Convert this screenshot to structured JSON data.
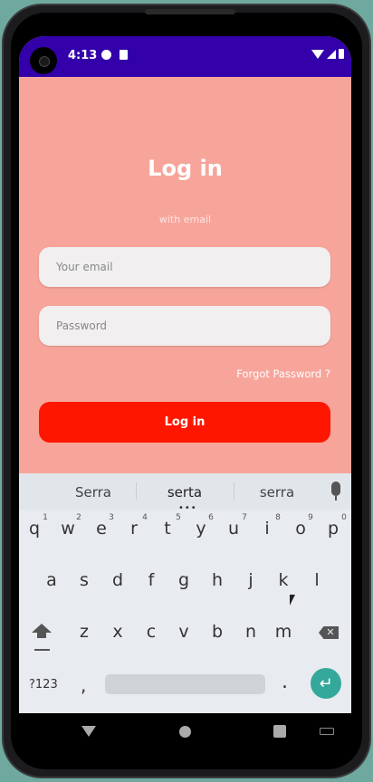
{
  "status": {
    "time": "4:13"
  },
  "login": {
    "title": "Log in",
    "subtitle": "with email",
    "email_placeholder": "Your email",
    "password_placeholder": "Password",
    "forgot": "Forgot Password ?",
    "login_button": "Log in"
  },
  "keyboard": {
    "suggestions": [
      "Serra",
      "serta",
      "serra"
    ],
    "row1": [
      "q",
      "w",
      "e",
      "r",
      "t",
      "y",
      "u",
      "i",
      "o",
      "p"
    ],
    "row1_hints": [
      "1",
      "2",
      "3",
      "4",
      "5",
      "6",
      "7",
      "8",
      "9",
      "0"
    ],
    "row2": [
      "a",
      "s",
      "d",
      "f",
      "g",
      "h",
      "j",
      "k",
      "l"
    ],
    "row3": [
      "z",
      "x",
      "c",
      "v",
      "b",
      "n",
      "m"
    ],
    "symbols_label": "?123",
    "comma": ",",
    "period": "."
  },
  "colors": {
    "background": "#f7a59b",
    "status_bar": "#3300aa",
    "login_button": "#ff1600",
    "enter_key": "#34a89b"
  }
}
